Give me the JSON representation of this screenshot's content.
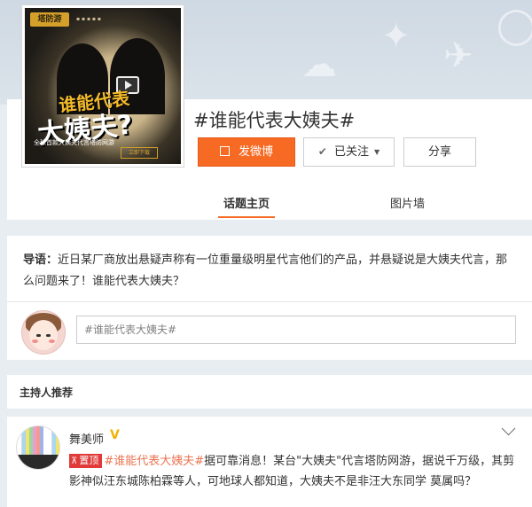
{
  "topic": {
    "title": "#谁能代表大姨夫#",
    "cover": {
      "logo": "塔防游",
      "title_line1": "谁能代表",
      "title_line2": "大姨夫?",
      "subtitle": "全球首款大姨夫代言塔防网游",
      "button": "立即下载"
    }
  },
  "actions": {
    "post_label": "发微博",
    "follow_label": "已关注",
    "share_label": "分享"
  },
  "tabs": [
    {
      "label": "话题主页",
      "active": true
    },
    {
      "label": "图片墙",
      "active": false
    }
  ],
  "guide": {
    "label": "导语：",
    "text": "近日某厂商放出悬疑声称有一位重量级明星代言他们的产品，并悬疑说是大姨夫代言，那么问题来了！谁能代表大姨夫？"
  },
  "compose": {
    "placeholder": "#谁能代表大姨夫#"
  },
  "host_section": {
    "label": "主持人推荐"
  },
  "post": {
    "author": "舞美师",
    "verified": true,
    "pin_label": "置顶",
    "tag": "#谁能代表大姨夫#",
    "body": "据可靠消息！某台\"大姨夫\"代言塔防网游，据说千万级，其剪影神似汪东城陈柏霖等人，可地球人都知道，大姨夫不是非汪大东同学 莫属吗？"
  },
  "colors": {
    "accent": "#f66a23",
    "link": "#eb7350",
    "pin": "#e03a3a",
    "verify": "#f2b200",
    "background": "#e8edf2"
  },
  "icons": {
    "post": "edit-icon",
    "follow": "check-icon",
    "follow_menu": "caret-down-icon",
    "pin": "pin-icon",
    "verify": "verified-v-icon",
    "post_menu": "chevron-down-icon",
    "cover_play": "play-icon"
  }
}
